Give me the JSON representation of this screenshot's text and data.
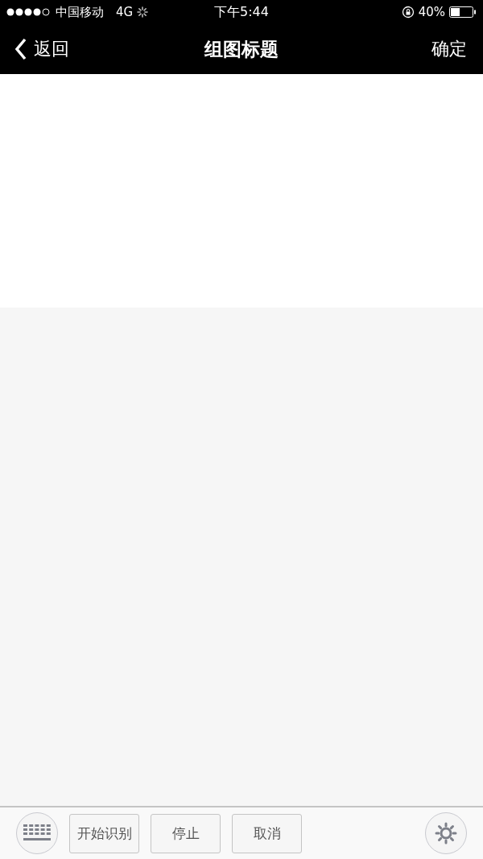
{
  "status_bar": {
    "carrier": "中国移动",
    "network": "4G",
    "time": "下午5:44",
    "battery": "40%"
  },
  "nav_bar": {
    "back": "返回",
    "title": "组图标题",
    "confirm": "确定"
  },
  "toolbar": {
    "buttons": [
      "开始识别",
      "停止",
      "取消"
    ]
  }
}
